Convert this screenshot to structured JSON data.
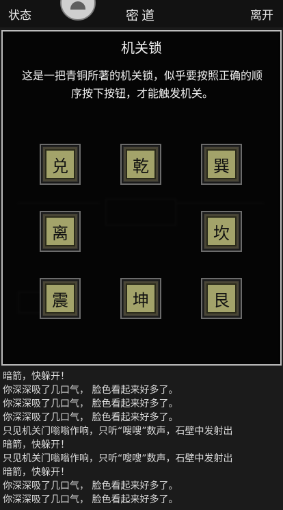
{
  "topbar": {
    "left_label": "状态",
    "title": "密道",
    "right_label": "离开"
  },
  "dialog": {
    "title": "机关锁",
    "description": "这是一把青铜所著的机关锁，似乎要按照正确的顺序按下按钮，才能触发机关。"
  },
  "buttons": {
    "dui": "兑",
    "qian": "乾",
    "xun": "巽",
    "li": "离",
    "kan": "坎",
    "zhen": "震",
    "kun": "坤",
    "gen": "艮"
  },
  "log": [
    "暗箭，快躲开！",
    "你深深吸了几口气，  脸色看起来好多了。",
    "你深深吸了几口气，  脸色看起来好多了。",
    "你深深吸了几口气，  脸色看起来好多了。",
    "只见机关门嗡嗡作响，只听“嗖嗖”数声，石壁中发射出",
    "暗箭，快躲开！",
    "只见机关门嗡嗡作响，只听“嗖嗖”数声，石壁中发射出",
    "暗箭，快躲开！",
    "你深深吸了几口气，  脸色看起来好多了。",
    "你深深吸了几口气，  脸色看起来好多了。"
  ],
  "colors": {
    "button_face": "#a3a36a",
    "dialog_border": "#bdbdbd"
  }
}
